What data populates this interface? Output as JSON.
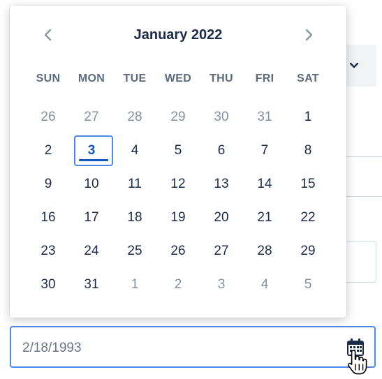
{
  "calendar": {
    "month_title": "January 2022",
    "weekdays": [
      "SUN",
      "MON",
      "TUE",
      "WED",
      "THU",
      "FRI",
      "SAT"
    ],
    "days": [
      {
        "label": "26",
        "outside": true
      },
      {
        "label": "27",
        "outside": true
      },
      {
        "label": "28",
        "outside": true
      },
      {
        "label": "29",
        "outside": true
      },
      {
        "label": "30",
        "outside": true
      },
      {
        "label": "31",
        "outside": true
      },
      {
        "label": "1",
        "outside": false
      },
      {
        "label": "2",
        "outside": false
      },
      {
        "label": "3",
        "outside": false,
        "today": true
      },
      {
        "label": "4",
        "outside": false
      },
      {
        "label": "5",
        "outside": false
      },
      {
        "label": "6",
        "outside": false
      },
      {
        "label": "7",
        "outside": false
      },
      {
        "label": "8",
        "outside": false
      },
      {
        "label": "9",
        "outside": false
      },
      {
        "label": "10",
        "outside": false
      },
      {
        "label": "11",
        "outside": false
      },
      {
        "label": "12",
        "outside": false
      },
      {
        "label": "13",
        "outside": false
      },
      {
        "label": "14",
        "outside": false
      },
      {
        "label": "15",
        "outside": false
      },
      {
        "label": "16",
        "outside": false
      },
      {
        "label": "17",
        "outside": false
      },
      {
        "label": "18",
        "outside": false
      },
      {
        "label": "19",
        "outside": false
      },
      {
        "label": "20",
        "outside": false
      },
      {
        "label": "21",
        "outside": false
      },
      {
        "label": "22",
        "outside": false
      },
      {
        "label": "23",
        "outside": false
      },
      {
        "label": "24",
        "outside": false
      },
      {
        "label": "25",
        "outside": false
      },
      {
        "label": "26",
        "outside": false
      },
      {
        "label": "27",
        "outside": false
      },
      {
        "label": "28",
        "outside": false
      },
      {
        "label": "29",
        "outside": false
      },
      {
        "label": "30",
        "outside": false
      },
      {
        "label": "31",
        "outside": false
      },
      {
        "label": "1",
        "outside": true
      },
      {
        "label": "2",
        "outside": true
      },
      {
        "label": "3",
        "outside": true
      },
      {
        "label": "4",
        "outside": true
      },
      {
        "label": "5",
        "outside": true
      }
    ],
    "icons": {
      "prev": "chevron-left-icon",
      "next": "chevron-right-icon"
    }
  },
  "date_field": {
    "value": "2/18/1993",
    "icon": "calendar-icon"
  },
  "colors": {
    "accent": "#4a8ae6",
    "today_text": "#1557c0",
    "title_text": "#1c2b4a",
    "muted_text": "#8590a0"
  }
}
